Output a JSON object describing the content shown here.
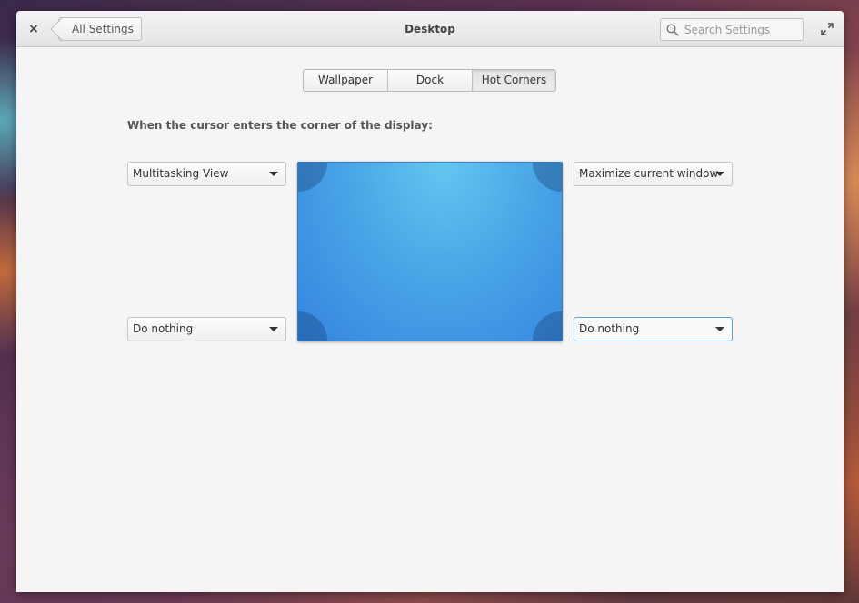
{
  "window": {
    "title": "Desktop",
    "back_label": "All Settings",
    "close_label": "×",
    "search_placeholder": "Search Settings"
  },
  "tabs": [
    {
      "label": "Wallpaper",
      "active": false
    },
    {
      "label": "Dock",
      "active": false
    },
    {
      "label": "Hot Corners",
      "active": true
    }
  ],
  "hot_corners": {
    "heading": "When the cursor enters the corner of the display:",
    "top_left": "Multitasking View",
    "top_right": "Maximize current window",
    "bottom_left": "Do nothing",
    "bottom_right": "Do nothing"
  },
  "colors": {
    "accent_focus": "#5aa0d8",
    "display_blue": "#3584e0"
  },
  "icons": {
    "close": "close-icon",
    "back": "chevron-left-icon",
    "search": "search-icon",
    "maximize": "maximize-icon",
    "dropdown": "chevron-down-icon"
  }
}
